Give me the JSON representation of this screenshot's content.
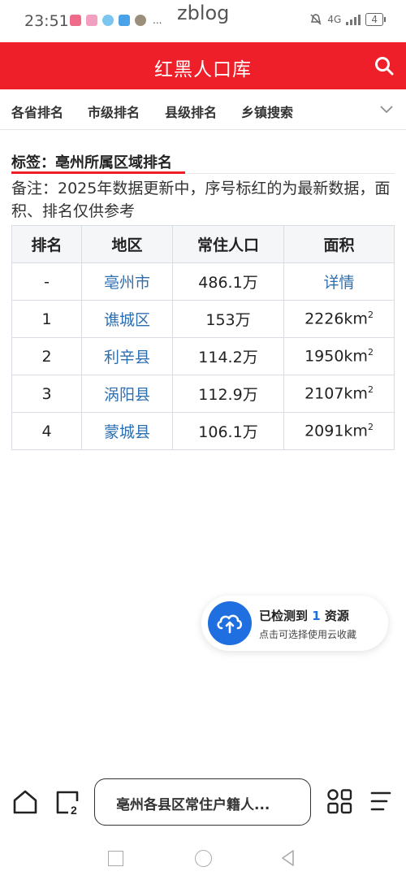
{
  "status_bar": {
    "time": "23:51",
    "more": "...",
    "network": "4G",
    "battery": "4"
  },
  "watermark": "zblog",
  "header": {
    "title": "红黑人口库"
  },
  "nav": {
    "tabs": [
      "各省排名",
      "市级排名",
      "县级排名",
      "乡镇搜索"
    ]
  },
  "content": {
    "tag": "标签：亳州所属区域排名",
    "note": "备注：2025年数据更新中，序号标红的为最新数据，面积、排名仅供参考"
  },
  "table": {
    "headers": [
      "排名",
      "地区",
      "常住人口",
      "面积"
    ],
    "rows": [
      {
        "rank": "-",
        "region": "亳州市",
        "population": "486.1万",
        "area": "详情",
        "area_sup": ""
      },
      {
        "rank": "1",
        "region": "谯城区",
        "population": "153万",
        "area": "2226km",
        "area_sup": "2"
      },
      {
        "rank": "2",
        "region": "利辛县",
        "population": "114.2万",
        "area": "1950km",
        "area_sup": "2"
      },
      {
        "rank": "3",
        "region": "涡阳县",
        "population": "112.9万",
        "area": "2107km",
        "area_sup": "2"
      },
      {
        "rank": "4",
        "region": "蒙城县",
        "population": "106.1万",
        "area": "2091km",
        "area_sup": "2"
      }
    ]
  },
  "cloud_toast": {
    "title_prefix": "已检测到",
    "count": "1",
    "title_suffix": "资源",
    "subtitle": "点击可选择使用云收藏"
  },
  "bottom_bar": {
    "tab_count": "2",
    "search_text": "亳州各县区常住户籍人..."
  },
  "colors": {
    "brand_red": "#ee1f29",
    "link_blue": "#2e6fb0",
    "cloud_blue": "#1f6fe0"
  }
}
